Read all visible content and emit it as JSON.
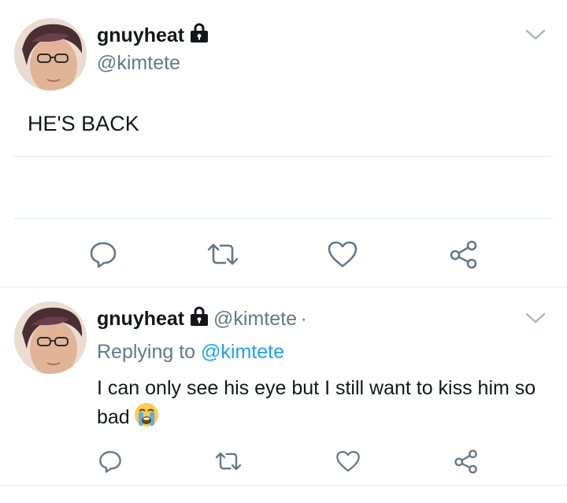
{
  "tweet": {
    "author_name": "gnuyheat",
    "author_handle": "@kimtete",
    "text": "HE'S BACK",
    "actions": [
      "reply-icon",
      "retweet-icon",
      "like-icon",
      "share-icon"
    ]
  },
  "reply": {
    "author_name": "gnuyheat",
    "author_handle": "@kimtete",
    "separator": "·",
    "replying_prefix": "Replying to",
    "replying_to": "@kimtete",
    "text": "I can only see his eye but I still want to kiss him so bad",
    "emoji": "crying-face-emoji",
    "actions": [
      "reply-icon",
      "retweet-icon",
      "like-icon",
      "share-icon"
    ]
  },
  "colors": {
    "text": "#14171a",
    "secondary": "#657786",
    "link": "#1da1f2",
    "divider": "#e1e8ed",
    "icon": "#657786"
  }
}
